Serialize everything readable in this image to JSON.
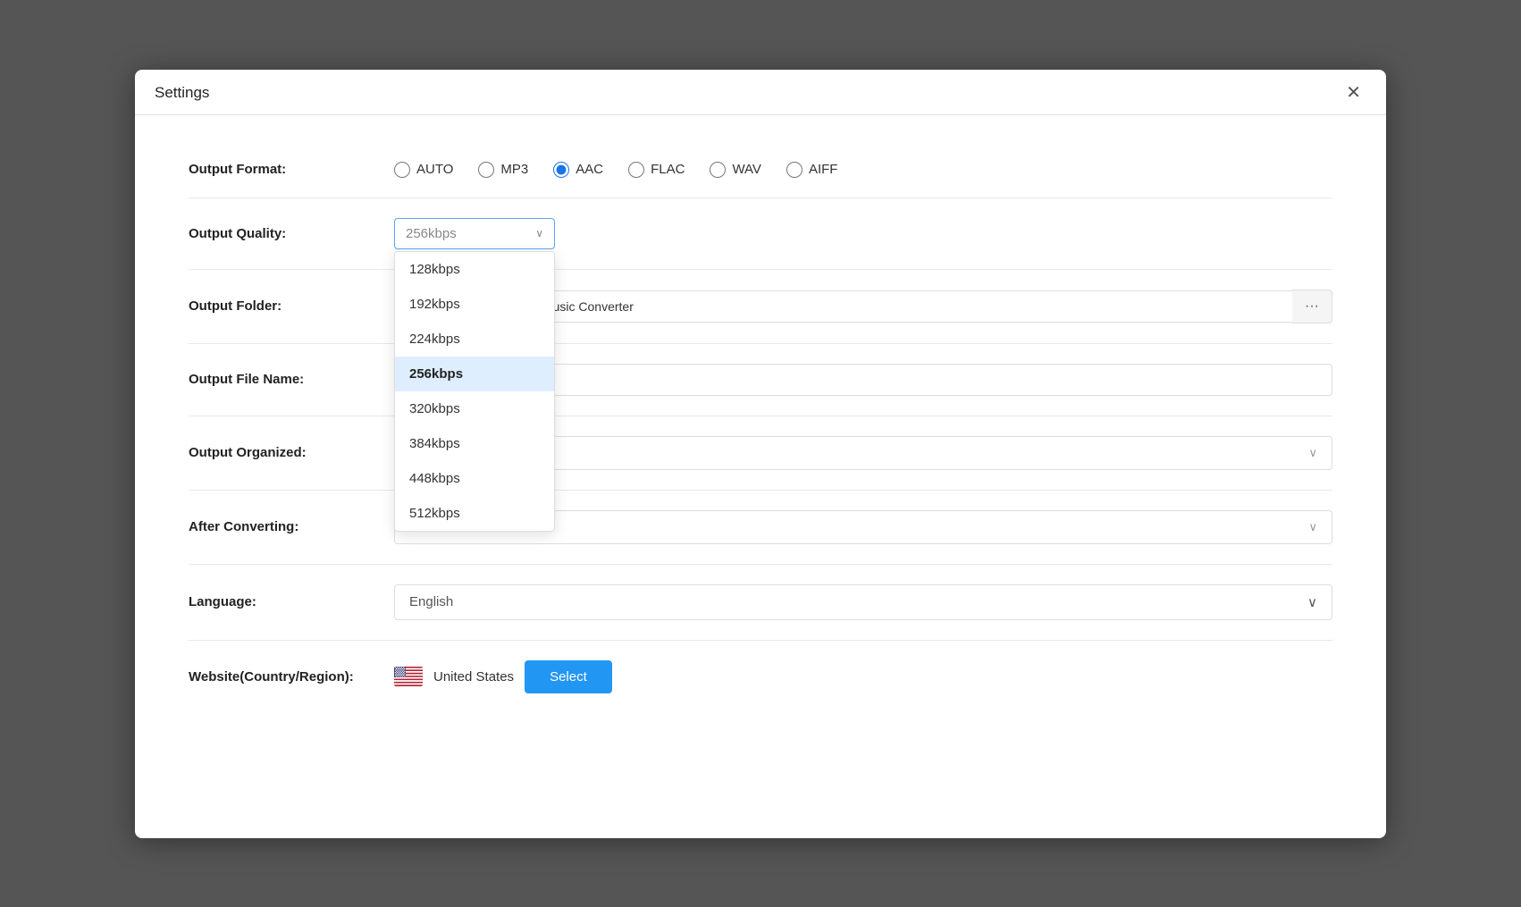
{
  "window": {
    "title": "Settings",
    "close_label": "✕"
  },
  "outputFormat": {
    "label": "Output Format:",
    "options": [
      "AUTO",
      "MP3",
      "AAC",
      "FLAC",
      "WAV",
      "AIFF"
    ],
    "selected": "AAC"
  },
  "outputQuality": {
    "label": "Output Quality:",
    "selected": "256kbps",
    "placeholder": "256kbps",
    "options": [
      "128kbps",
      "192kbps",
      "224kbps",
      "256kbps",
      "320kbps",
      "384kbps",
      "448kbps",
      "512kbps"
    ]
  },
  "outputFolder": {
    "label": "Output Folder:",
    "path": "nents\\Ukeysoft Amazon Music Converter",
    "browse_label": "···"
  },
  "outputFileName": {
    "label": "Output File Name:",
    "value": ""
  },
  "outputOrganized": {
    "label": "Output Organized:",
    "value": "",
    "placeholder": ""
  },
  "afterConverting": {
    "label": "After Converting:",
    "value": "",
    "placeholder": ""
  },
  "language": {
    "label": "Language:",
    "value": "English"
  },
  "websiteCountry": {
    "label": "Website(Country/Region):",
    "country": "United States",
    "select_label": "Select"
  }
}
